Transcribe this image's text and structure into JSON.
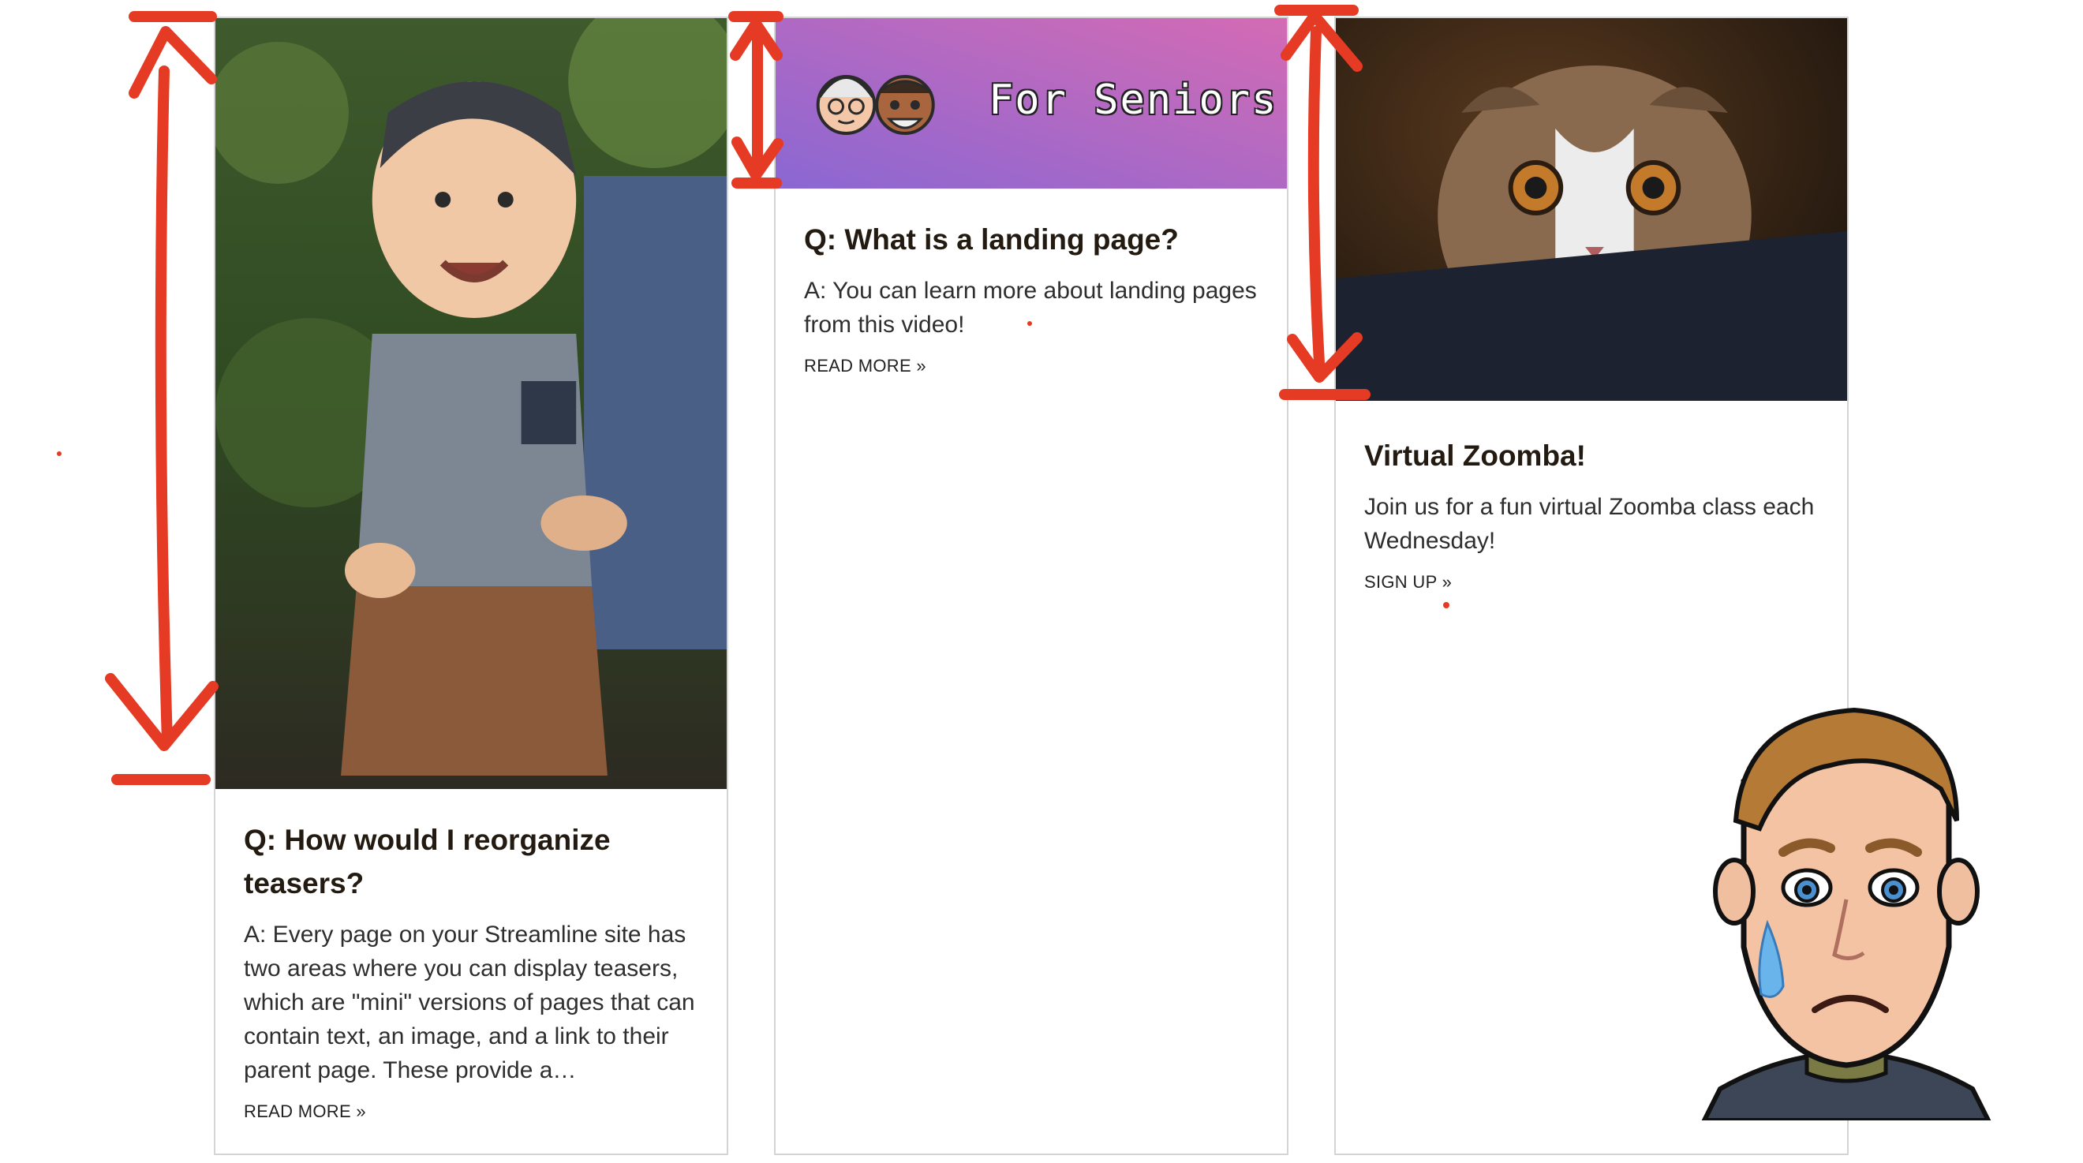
{
  "cards": [
    {
      "image": "baby-photo",
      "title": "Q: How would I reorganize teasers?",
      "text": "A: Every page on your Streamline site has two areas where you can display teasers, which are \"mini\" versions of pages that can contain text, an image, and a link to their parent page. These provide a…",
      "link": "READ MORE »"
    },
    {
      "image": "for-seniors-banner",
      "banner_text": "For Seniors",
      "title": "Q: What is a landing page?",
      "text": "A: You can learn more about landing pages from this video!",
      "link": "READ MORE »"
    },
    {
      "image": "cat-photo",
      "title": "Virtual Zoomba!",
      "text": "Join us for a fun virtual Zoomba class each Wednesday!",
      "link": "SIGN UP »"
    }
  ],
  "colors": {
    "annotation": "#e53a23",
    "banner_start": "#8a67d3",
    "banner_end": "#d46bb4",
    "card_border": "#d4d4d4",
    "heading": "#231b12"
  },
  "icons": [
    "double-arrow-annotation",
    "crying-avatar"
  ]
}
